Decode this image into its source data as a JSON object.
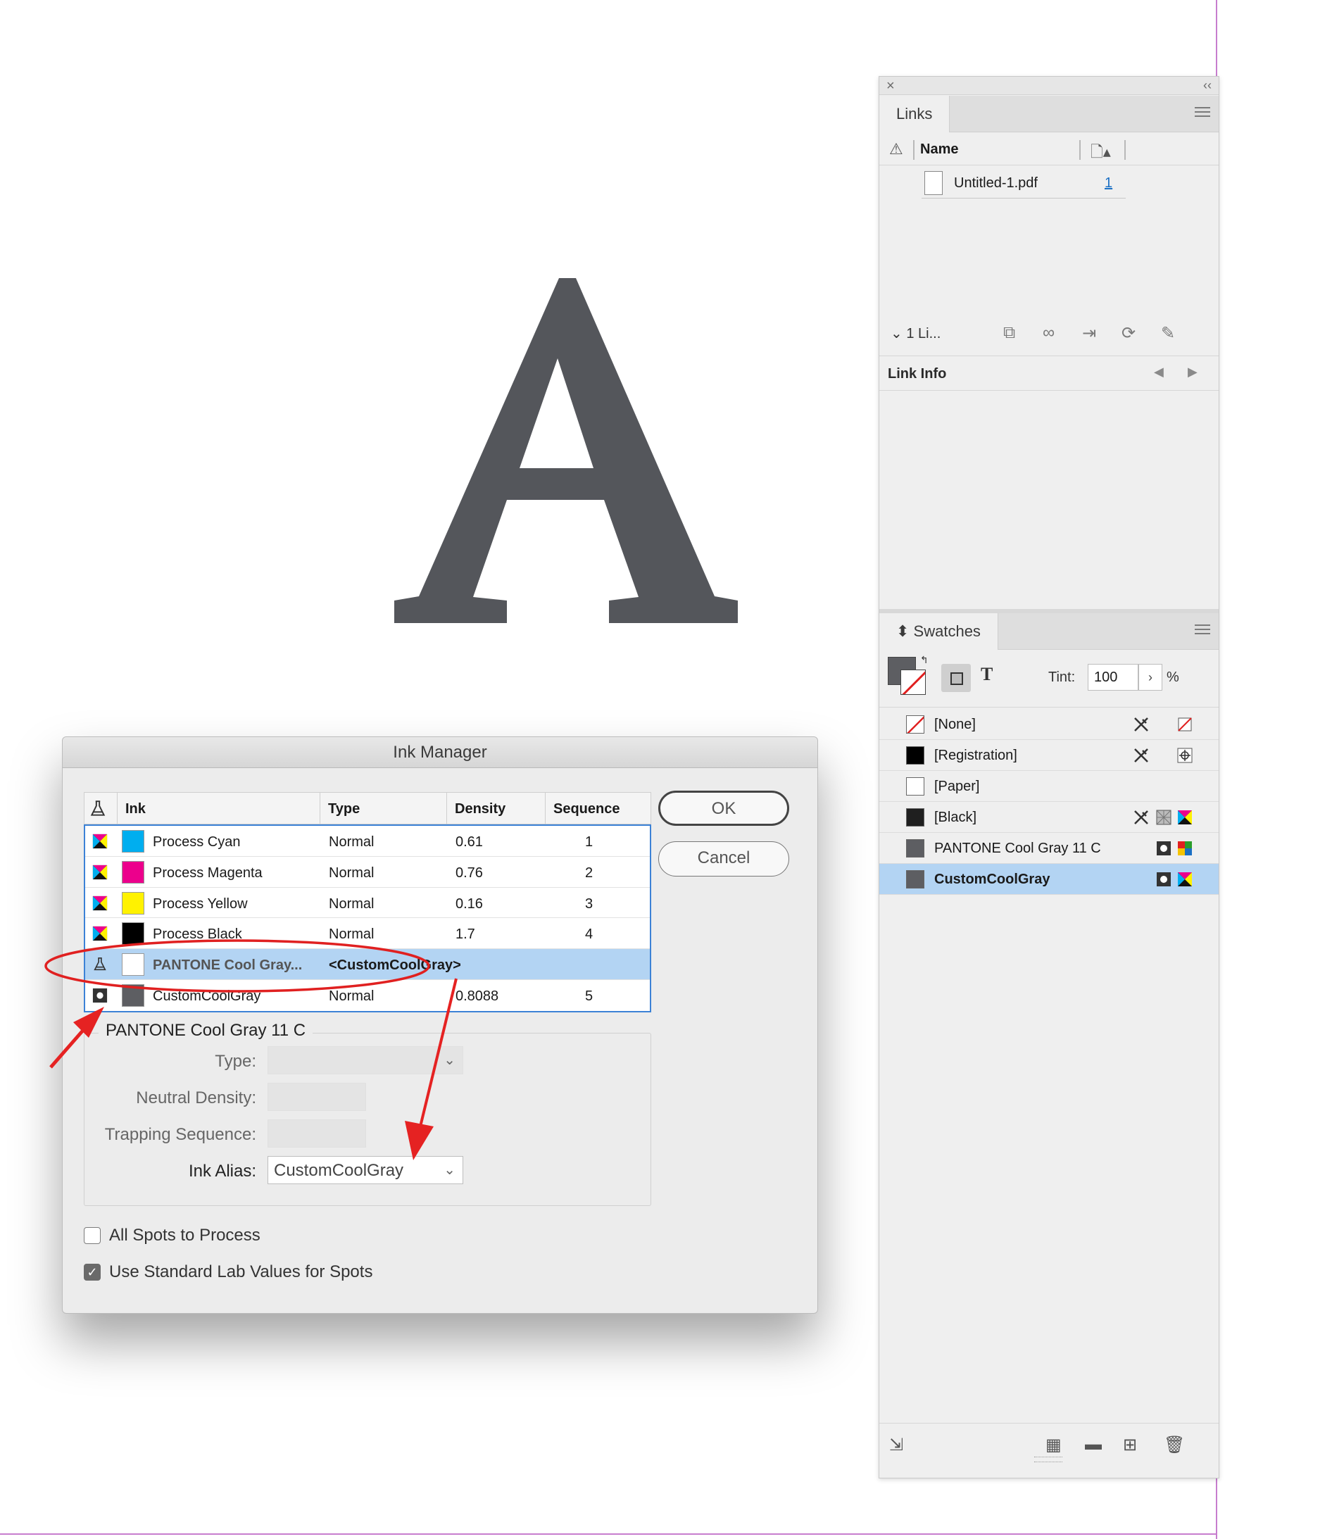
{
  "canvas": {
    "letter": "A"
  },
  "links_panel": {
    "tab": "Links",
    "col_name": "Name",
    "file": "Untitled-1.pdf",
    "page": "1",
    "count": "1 Li...",
    "link_info": "Link Info"
  },
  "swatches_panel": {
    "tab": "Swatches",
    "tint_label": "Tint:",
    "tint_value": "100",
    "tint_unit": "%",
    "text_mode": "T",
    "items": [
      {
        "name": "[None]",
        "color": "#ffffff"
      },
      {
        "name": "[Registration]",
        "color": "#000000"
      },
      {
        "name": "[Paper]",
        "color": "#ffffff"
      },
      {
        "name": "[Black]",
        "color": "#1f1f1f"
      },
      {
        "name": "PANTONE Cool Gray 11 C",
        "color": "#5d5e62"
      },
      {
        "name": "CustomCoolGray",
        "color": "#5d5e62"
      }
    ]
  },
  "ink_manager": {
    "title": "Ink Manager",
    "headers": {
      "ink": "Ink",
      "type": "Type",
      "density": "Density",
      "sequence": "Sequence"
    },
    "rows": [
      {
        "name": "Process Cyan",
        "type": "Normal",
        "density": "0.61",
        "sequence": "1",
        "color": "#00aeef"
      },
      {
        "name": "Process Magenta",
        "type": "Normal",
        "density": "0.76",
        "sequence": "2",
        "color": "#ec008c"
      },
      {
        "name": "Process Yellow",
        "type": "Normal",
        "density": "0.16",
        "sequence": "3",
        "color": "#fff200"
      },
      {
        "name": "Process Black",
        "type": "Normal",
        "density": "1.7",
        "sequence": "4",
        "color": "#000000"
      },
      {
        "name": "PANTONE Cool Gray...",
        "alias": "<CustomCoolGray>",
        "color": "#ffffff"
      },
      {
        "name": "CustomCoolGray",
        "type": "Normal",
        "density": "0.8088",
        "sequence": "5",
        "color": "#5d5e62"
      }
    ],
    "ok": "OK",
    "cancel": "Cancel",
    "group_title": "PANTONE Cool Gray 11 C",
    "type_label": "Type:",
    "neutral_density_label": "Neutral Density:",
    "trapping_label": "Trapping Sequence:",
    "ink_alias_label": "Ink Alias:",
    "ink_alias_value": "CustomCoolGray",
    "all_spots": "All Spots to Process",
    "all_spots_checked": false,
    "std_lab": "Use Standard Lab Values for Spots",
    "std_lab_checked": true
  }
}
